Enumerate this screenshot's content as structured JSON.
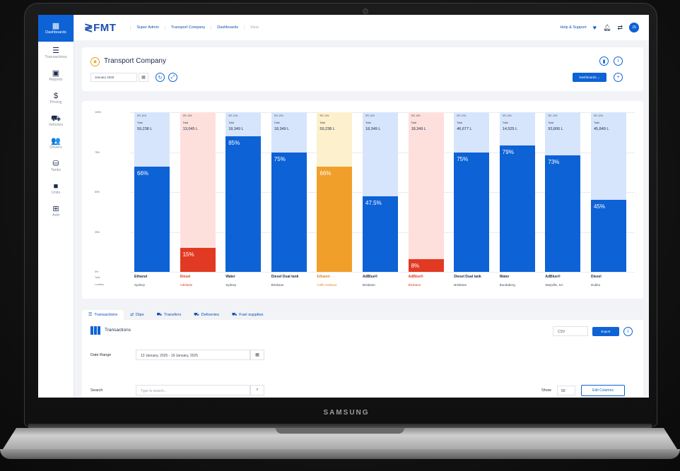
{
  "device": {
    "brand": "SAMSUNG"
  },
  "sidebar": {
    "items": [
      {
        "label": "Dashboards",
        "icon": "chart-bar-icon",
        "glyph": "▦"
      },
      {
        "label": "Transactions",
        "icon": "list-icon",
        "glyph": "☰"
      },
      {
        "label": "Reports",
        "icon": "clipboard-icon",
        "glyph": "▣"
      },
      {
        "label": "Pricing",
        "icon": "dollar-icon",
        "glyph": "$"
      },
      {
        "label": "Vehicles",
        "icon": "car-icon",
        "glyph": "⛟"
      },
      {
        "label": "Drivers",
        "icon": "users-icon",
        "glyph": "👥"
      },
      {
        "label": "Tanks",
        "icon": "database-icon",
        "glyph": "⛁"
      },
      {
        "label": "Units",
        "icon": "square-icon",
        "glyph": "■"
      },
      {
        "label": "Add",
        "icon": "plus-square-icon",
        "glyph": "⊞"
      }
    ]
  },
  "topbar": {
    "logo": "≷FMT",
    "breadcrumbs": [
      "Super Admin",
      "Transport Company",
      "Dashboards",
      "View"
    ],
    "help": "Help & Support",
    "avatar": "JS"
  },
  "header": {
    "title": "Transport Company",
    "date": "January 2025",
    "dashboards_button": "Dashboards  ⌄"
  },
  "chart": {
    "y_ticks": [
      "100%",
      "75%",
      "50%",
      "25%",
      "0%"
    ],
    "row_labels": [
      "Tank",
      "Location"
    ],
    "tanks": [
      {
        "mini": "SFL 10%",
        "total_label": "Total",
        "total": "59,238 L",
        "percent": 66,
        "percent_label": "66%",
        "fuel": "Ethanol",
        "location": "Sydney",
        "fill": "#0d62d6",
        "empty": "#d6e5fb",
        "text": "#1b2a4a"
      },
      {
        "mini": "SFL 10%",
        "total_label": "Total",
        "total": "13,045 L",
        "percent": 15,
        "percent_label": "15%",
        "fuel": "Diesel",
        "location": "Adelaide",
        "fill": "#e23a22",
        "empty": "#fde0dc",
        "text": "#e23a22"
      },
      {
        "mini": "SFL 10%",
        "total_label": "Total",
        "total": "18,349 L",
        "percent": 85,
        "percent_label": "85%",
        "fuel": "Water",
        "location": "Sydney",
        "fill": "#0d62d6",
        "empty": "#d6e5fb",
        "text": "#1b2a4a"
      },
      {
        "mini": "SFL 10%",
        "total_label": "Total",
        "total": "18,349 L",
        "percent": 75,
        "percent_label": "75%",
        "fuel": "Diesel Dual tank",
        "location": "Brisbane",
        "fill": "#0d62d6",
        "empty": "#d6e5fb",
        "text": "#1b2a4a"
      },
      {
        "mini": "SFL 10%",
        "total_label": "Total",
        "total": "59,238 L",
        "percent": 66,
        "percent_label": "66%",
        "fuel": "Ethanol",
        "location": "Coffs Harbour",
        "fill": "#f0a02a",
        "empty": "#fdf0cc",
        "text": "#e0861a"
      },
      {
        "mini": "SFL 10%",
        "total_label": "Total",
        "total": "18,349 L",
        "percent": 47.5,
        "percent_label": "47.5%",
        "fuel": "AdBlue®",
        "location": "Brisbane",
        "fill": "#0d62d6",
        "empty": "#d6e5fb",
        "text": "#1b2a4a"
      },
      {
        "mini": "SFL 10%",
        "total_label": "Total",
        "total": "18,349 L",
        "percent": 8,
        "percent_label": "8%",
        "fuel": "AdBlue®",
        "location": "Brisbane",
        "fill": "#e23a22",
        "empty": "#fde0dc",
        "text": "#e23a22"
      },
      {
        "mini": "SFL 10%",
        "total_label": "Total",
        "total": "46,677 L",
        "percent": 75,
        "percent_label": "75%",
        "fuel": "Diesel Dual tank",
        "location": "Brisbane",
        "fill": "#0d62d6",
        "empty": "#d6e5fb",
        "text": "#1b2a4a"
      },
      {
        "mini": "SFL 10%",
        "total_label": "Total",
        "total": "14,525 L",
        "percent": 79,
        "percent_label": "79%",
        "fuel": "Water",
        "location": "Bundaberg",
        "fill": "#0d62d6",
        "empty": "#d6e5fb",
        "text": "#1b2a4a"
      },
      {
        "mini": "SFL 10%",
        "total_label": "Total",
        "total": "93,806 L",
        "percent": 73,
        "percent_label": "73%",
        "fuel": "AdBlue®",
        "location": "Wayville, SA",
        "fill": "#0d62d6",
        "empty": "#d6e5fb",
        "text": "#1b2a4a"
      },
      {
        "mini": "SFL 10%",
        "total_label": "Total",
        "total": "45,849 L",
        "percent": 45,
        "percent_label": "45%",
        "fuel": "Diesel",
        "location": "Dubbo",
        "fill": "#0d62d6",
        "empty": "#d6e5fb",
        "text": "#1b2a4a"
      }
    ]
  },
  "tabs": [
    {
      "label": "Transactions",
      "icon": "list-icon",
      "glyph": "☰"
    },
    {
      "label": "Dips",
      "icon": "swap-icon",
      "glyph": "⇄"
    },
    {
      "label": "Transfers",
      "icon": "truck-icon",
      "glyph": "⛟"
    },
    {
      "label": "Deliveries",
      "icon": "truck-icon",
      "glyph": "⛟"
    },
    {
      "label": "Fuel supplies",
      "icon": "truck-icon",
      "glyph": "⛟"
    }
  ],
  "transactions": {
    "title": "Transactions",
    "format": "CSV",
    "export": "Export",
    "date_range_label": "Date Range",
    "date_range_value": "13 January, 2025 - 19 January, 2025",
    "search_label": "Search",
    "search_placeholder": "Type to search...",
    "show_label": "Show",
    "show_value": "50",
    "edit_columns": "Edit Columns"
  }
}
